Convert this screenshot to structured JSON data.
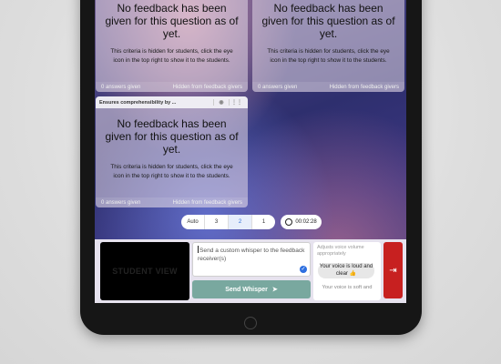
{
  "cards": [
    {
      "title": "",
      "big": "No feedback has been given for this question as of yet.",
      "hint": "This criteria is hidden for students, click the eye icon in the top right to show it to the students.",
      "answers": "0 answers given",
      "hidden": "Hidden from feedback givers"
    },
    {
      "title": "",
      "big": "No feedback has been given for this question as of yet.",
      "hint": "This criteria is hidden for students, click the eye icon in the top right to show it to the students.",
      "answers": "0 answers given",
      "hidden": "Hidden from feedback givers"
    },
    {
      "title": "Ensures comprehensibility by ...",
      "big": "No feedback has been given for this question as of yet.",
      "hint": "This criteria is hidden for students, click the eye icon in the top right to show it to the students.",
      "answers": "0 answers given",
      "hidden": "Hidden from feedback givers"
    }
  ],
  "pager": {
    "items": [
      "Auto",
      "3",
      "2",
      "1"
    ],
    "active": "2"
  },
  "timer": "00:02:28",
  "student_view": "STUDENT VIEW",
  "whisper": {
    "placeholder": "Send a custom whisper to the feedback receiver(s)",
    "send_label": "Send Whisper"
  },
  "voice": {
    "hint": "Adjusts voice volume appropriately",
    "loud": "Your voice is loud and clear",
    "soft": "Your voice is soft and"
  },
  "icons": {
    "eye": "eye-icon",
    "drag": "drag-handle-icon",
    "clock": "clock-icon",
    "check": "check-icon",
    "send": "paper-plane-icon",
    "exit": "exit-icon"
  },
  "colors": {
    "send": "#79a89f",
    "exit": "#c72020",
    "active_page": "#2f6fd6"
  }
}
